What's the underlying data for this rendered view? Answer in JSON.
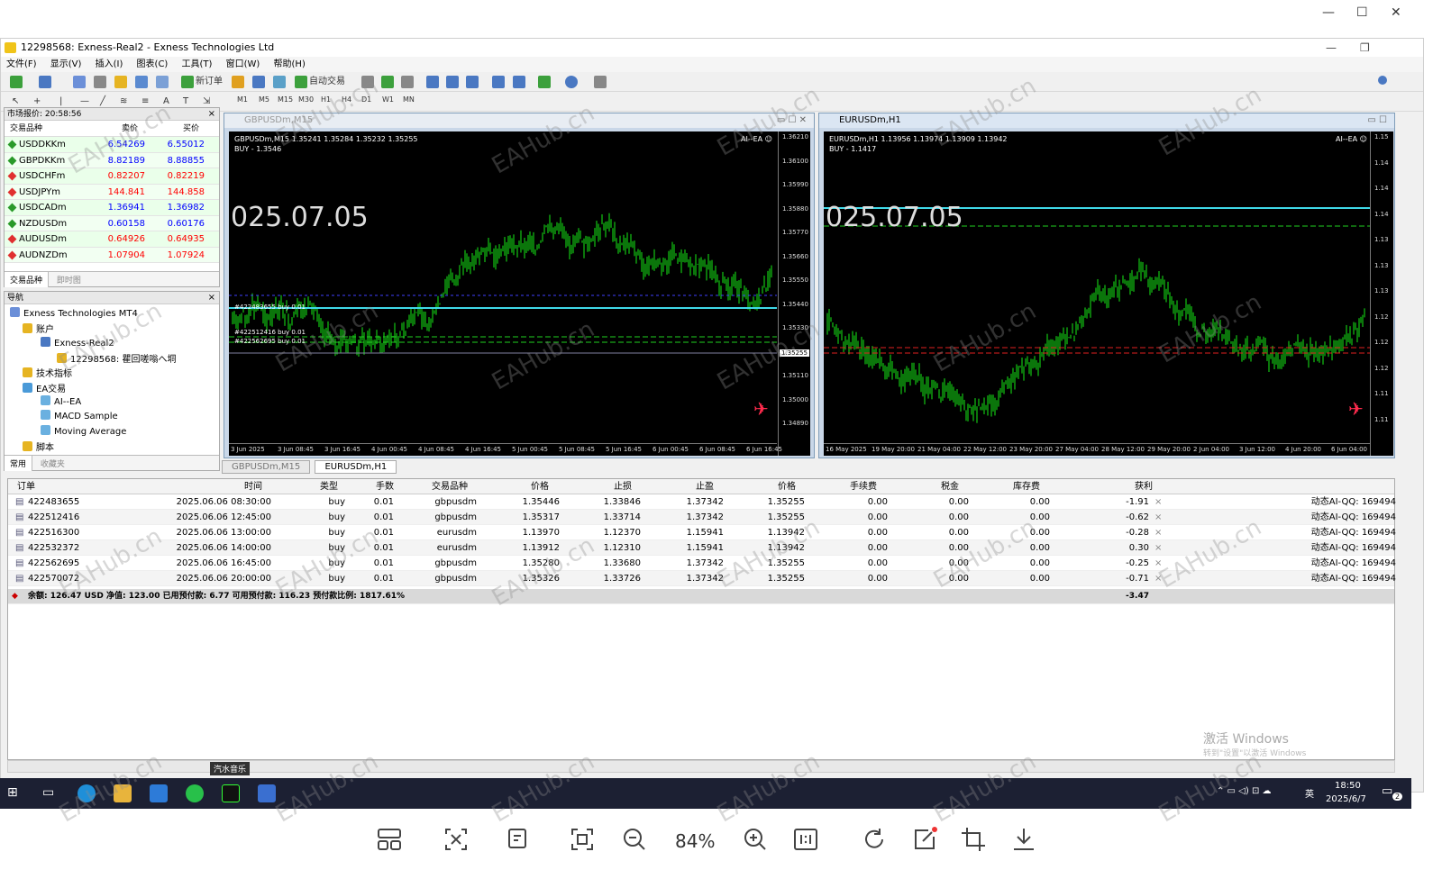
{
  "window": {
    "title": "12298568: Exness-Real2 - Exness Technologies Ltd"
  },
  "menu": [
    "文件(F)",
    "显示(V)",
    "插入(I)",
    "图表(C)",
    "工具(T)",
    "窗口(W)",
    "帮助(H)"
  ],
  "toolbar": {
    "new_order": "新订单",
    "auto_trading": "自动交易",
    "timeframes": [
      "M1",
      "M5",
      "M15",
      "M30",
      "H1",
      "H4",
      "D1",
      "W1",
      "MN"
    ]
  },
  "market_watch": {
    "title": "市场报价: 20:58:56",
    "col_symbol": "交易品种",
    "col_bid": "卖价",
    "col_ask": "买价",
    "rows": [
      {
        "symbol": "USDDKKm",
        "bid": "6.54269",
        "ask": "6.55012",
        "color": "#0000ff"
      },
      {
        "symbol": "GBPDKKm",
        "bid": "8.82189",
        "ask": "8.88855",
        "color": "#0000ff"
      },
      {
        "symbol": "USDCHFm",
        "bid": "0.82207",
        "ask": "0.82219",
        "color": "#ff0000"
      },
      {
        "symbol": "USDJPYm",
        "bid": "144.841",
        "ask": "144.858",
        "color": "#ff0000"
      },
      {
        "symbol": "USDCADm",
        "bid": "1.36941",
        "ask": "1.36982",
        "color": "#0000ff"
      },
      {
        "symbol": "NZDUSDm",
        "bid": "0.60158",
        "ask": "0.60176",
        "color": "#0000ff"
      },
      {
        "symbol": "AUDUSDm",
        "bid": "0.64926",
        "ask": "0.64935",
        "color": "#ff0000"
      },
      {
        "symbol": "AUDNZDm",
        "bid": "1.07904",
        "ask": "1.07924",
        "color": "#ff0000"
      }
    ],
    "tabs": [
      "交易品种",
      "即时图"
    ]
  },
  "navigator": {
    "title": "导航",
    "items": [
      "Exness Technologies MT4",
      "账户",
      "Exness-Real2",
      "12298568: 瞿回嗟嗡へ垌",
      "技术指标",
      "EA交易",
      "AI--EA",
      "MACD Sample",
      "Moving Average",
      "脚本"
    ],
    "tabs": [
      "常用",
      "收藏夹"
    ]
  },
  "chart1": {
    "title": "GBPUSDm,M15",
    "info_line": "GBPUSDm,M15  1.35241 1.35284 1.35232 1.35255",
    "buy_line": "BUY - 1.3546",
    "date_overlay": "025.07.05",
    "ea": "AI--EA ☺",
    "prices": [
      "1.36210",
      "1.36100",
      "1.35990",
      "1.35880",
      "1.35770",
      "1.35660",
      "1.35550",
      "1.35440",
      "1.35330",
      "1.35220",
      "1.35110",
      "1.35000",
      "1.34890"
    ],
    "current_price": "1.35255",
    "times": [
      "3 Jun 2025",
      "3 Jun 08:45",
      "3 Jun 16:45",
      "4 Jun 00:45",
      "4 Jun 08:45",
      "4 Jun 16:45",
      "5 Jun 00:45",
      "5 Jun 08:45",
      "5 Jun 16:45",
      "6 Jun 00:45",
      "6 Jun 08:45",
      "6 Jun 16:45"
    ],
    "order_labels": [
      "#422483655 buy 0.01",
      "#422512416 buy 0.01",
      "#422562695 buy 0.01"
    ]
  },
  "chart2": {
    "title": "EURUSDm,H1",
    "info_line": "EURUSDm,H1  1.13956 1.13974 1.13909 1.13942",
    "buy_line": "BUY - 1.1417",
    "date_overlay": "025.07.05",
    "ea": "AI--EA ☺",
    "times": [
      "16 May 2025",
      "19 May 20:00",
      "21 May 04:00",
      "22 May 12:00",
      "23 May 20:00",
      "27 May 04:00",
      "28 May 12:00",
      "29 May 20:00",
      "2 Jun 04:00",
      "3 Jun 12:00",
      "4 Jun 20:00",
      "6 Jun 04:00"
    ],
    "prices": [
      "1.15",
      "1.14",
      "1.14",
      "1.14",
      "1.13",
      "1.13",
      "1.13",
      "1.12",
      "1.12",
      "1.12",
      "1.11",
      "1.11"
    ]
  },
  "chart_tabs": [
    "GBPUSDm,M15",
    "EURUSDm,H1"
  ],
  "terminal": {
    "headers": [
      "订单",
      "时间",
      "类型",
      "手数",
      "交易品种",
      "价格",
      "止损",
      "止盈",
      "价格",
      "手续费",
      "税金",
      "库存费",
      "获利"
    ],
    "rows": [
      {
        "ticket": "422483655",
        "time": "2025.06.06 08:30:00",
        "type": "buy",
        "lots": "0.01",
        "symbol": "gbpusdm",
        "open": "1.35446",
        "sl": "1.33846",
        "tp": "1.37342",
        "price": "1.35255",
        "commission": "0.00",
        "tax": "0.00",
        "swap": "0.00",
        "profit": "-1.91",
        "comment": "动态AI-QQ: 169494"
      },
      {
        "ticket": "422512416",
        "time": "2025.06.06 12:45:00",
        "type": "buy",
        "lots": "0.01",
        "symbol": "gbpusdm",
        "open": "1.35317",
        "sl": "1.33714",
        "tp": "1.37342",
        "price": "1.35255",
        "commission": "0.00",
        "tax": "0.00",
        "swap": "0.00",
        "profit": "-0.62",
        "comment": "动态AI-QQ: 169494"
      },
      {
        "ticket": "422516300",
        "time": "2025.06.06 13:00:00",
        "type": "buy",
        "lots": "0.01",
        "symbol": "eurusdm",
        "open": "1.13970",
        "sl": "1.12370",
        "tp": "1.15941",
        "price": "1.13942",
        "commission": "0.00",
        "tax": "0.00",
        "swap": "0.00",
        "profit": "-0.28",
        "comment": "动态AI-QQ: 169494"
      },
      {
        "ticket": "422532372",
        "time": "2025.06.06 14:00:00",
        "type": "buy",
        "lots": "0.01",
        "symbol": "eurusdm",
        "open": "1.13912",
        "sl": "1.12310",
        "tp": "1.15941",
        "price": "1.13942",
        "commission": "0.00",
        "tax": "0.00",
        "swap": "0.00",
        "profit": "0.30",
        "comment": "动态AI-QQ: 169494"
      },
      {
        "ticket": "422562695",
        "time": "2025.06.06 16:45:00",
        "type": "buy",
        "lots": "0.01",
        "symbol": "gbpusdm",
        "open": "1.35280",
        "sl": "1.33680",
        "tp": "1.37342",
        "price": "1.35255",
        "commission": "0.00",
        "tax": "0.00",
        "swap": "0.00",
        "profit": "-0.25",
        "comment": "动态AI-QQ: 169494"
      },
      {
        "ticket": "422570072",
        "time": "2025.06.06 20:00:00",
        "type": "buy",
        "lots": "0.01",
        "symbol": "gbpusdm",
        "open": "1.35326",
        "sl": "1.33726",
        "tp": "1.37342",
        "price": "1.35255",
        "commission": "0.00",
        "tax": "0.00",
        "swap": "0.00",
        "profit": "-0.71",
        "comment": "动态AI-QQ: 169494"
      }
    ],
    "summary": "余额: 126.47 USD  净值: 123.00  已用预付款: 6.77  可用预付款: 116.23  预付款比例: 1817.61%",
    "total_profit": "-3.47"
  },
  "activation": {
    "line1": "激活 Windows",
    "line2": "转到\"设置\"以激活 Windows"
  },
  "tooltip": "汽水音乐",
  "taskbar": {
    "lang": "英",
    "time": "18:50",
    "date": "2025/6/7",
    "badge": "2"
  },
  "viewer": {
    "zoom": "84%"
  },
  "watermark": "EAHub.cn"
}
